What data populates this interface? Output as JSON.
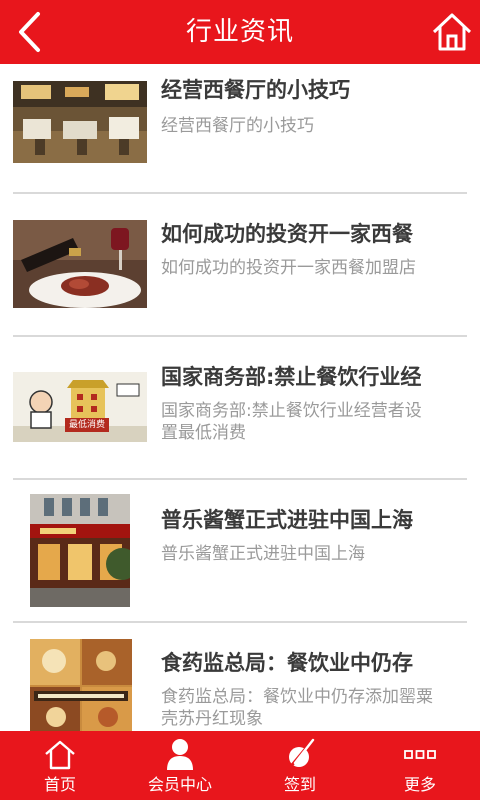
{
  "header": {
    "title": "行业资讯",
    "back_icon": "chevron-left-icon",
    "home_icon": "home-icon"
  },
  "news": [
    {
      "title": "经营西餐厅的小技巧",
      "summary": "经营西餐厅的小技巧"
    },
    {
      "title": "如何成功的投资开一家西餐",
      "summary": "如何成功的投资开一家西餐加盟店"
    },
    {
      "title": "国家商务部:禁止餐饮行业经",
      "summary": "国家商务部:禁止餐饮行业经营者设置最低消费",
      "thumb_caption": "最低消费"
    },
    {
      "title": "普乐酱蟹正式进驻中国上海",
      "summary": "普乐酱蟹正式进驻中国上海"
    },
    {
      "title": "食药监总局：餐饮业中仍存",
      "summary": "食药监总局：餐饮业中仍存添加罂粟壳苏丹红现象"
    }
  ],
  "tabs": [
    {
      "label": "首页",
      "icon": "home-icon"
    },
    {
      "label": "会员中心",
      "icon": "user-icon"
    },
    {
      "label": "签到",
      "icon": "sign-in-icon"
    },
    {
      "label": "更多",
      "icon": "more-icon"
    }
  ],
  "colors": {
    "brand_red": "#e8161c",
    "title_text": "#3a3a3a",
    "summary_text": "#9a9a9a",
    "divider": "#d9d9d9"
  }
}
